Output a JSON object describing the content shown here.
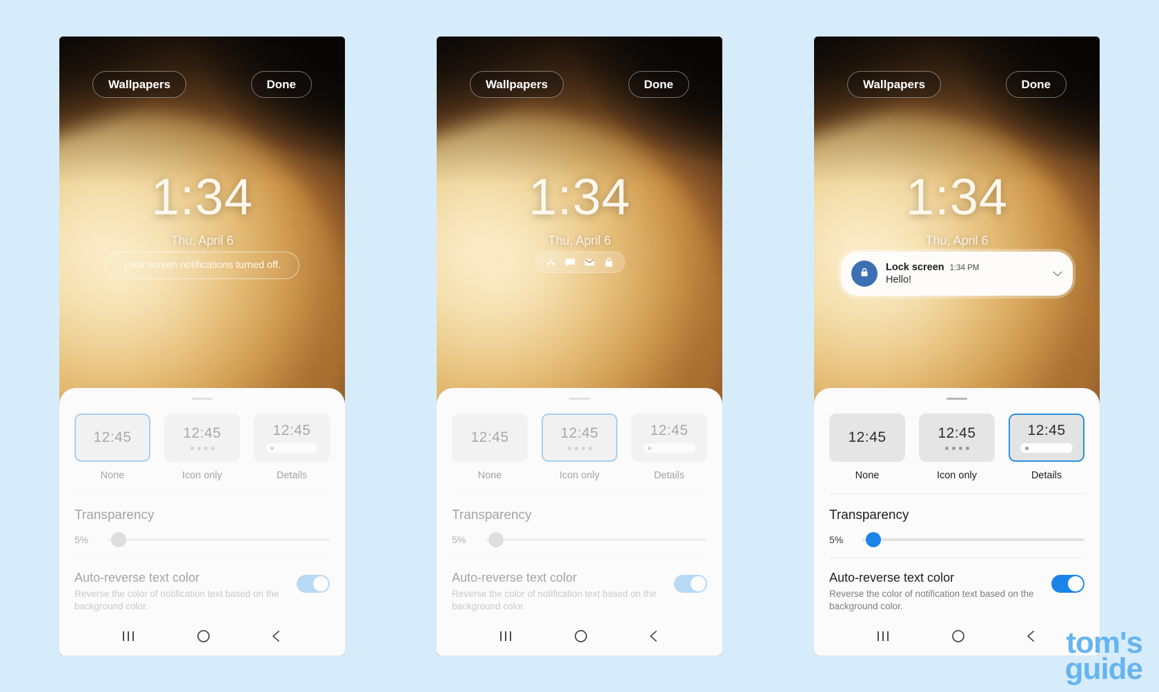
{
  "background_color": "#d6ecfb",
  "accent_color": "#1a84e8",
  "watermark": {
    "line1": "tom's",
    "line2": "guide",
    "color": "#66b4f0"
  },
  "lockscreen": {
    "wallpapers_button": "Wallpapers",
    "done_button": "Done",
    "clock": "1:34",
    "date": "Thu, April 6"
  },
  "panels": [
    {
      "id": "none",
      "notification_style": "none",
      "notif_off_text": "Lock screen notifications turned off.",
      "sheet_active": false,
      "selected_tile": 0
    },
    {
      "id": "icon-only",
      "notification_style": "icons",
      "icons": [
        "missed-call-icon",
        "message-icon",
        "email-icon",
        "lock-icon"
      ],
      "sheet_active": false,
      "selected_tile": 1
    },
    {
      "id": "details",
      "notification_style": "card",
      "card": {
        "app_name": "Lock screen",
        "time": "1:34 PM",
        "message": "Hello!",
        "avatar_icon": "lock-icon",
        "avatar_color": "#3d6fb4",
        "expand_icon": "chevron-down-icon"
      },
      "sheet_active": true,
      "selected_tile": 2
    }
  ],
  "sheet": {
    "tiles": [
      {
        "time": "12:45",
        "label": "None",
        "preview": "plain"
      },
      {
        "time": "12:45",
        "label": "Icon only",
        "preview": "dots"
      },
      {
        "time": "12:45",
        "label": "Details",
        "preview": "bar"
      }
    ],
    "transparency": {
      "title": "Transparency",
      "value_label": "5%",
      "value": 5,
      "min": 0,
      "max": 100
    },
    "auto_reverse": {
      "title": "Auto-reverse text color",
      "description": "Reverse the color of notification text based on the background color.",
      "enabled": true
    }
  },
  "navbar": {
    "recents": "recents-icon",
    "home": "home-icon",
    "back": "back-icon"
  }
}
